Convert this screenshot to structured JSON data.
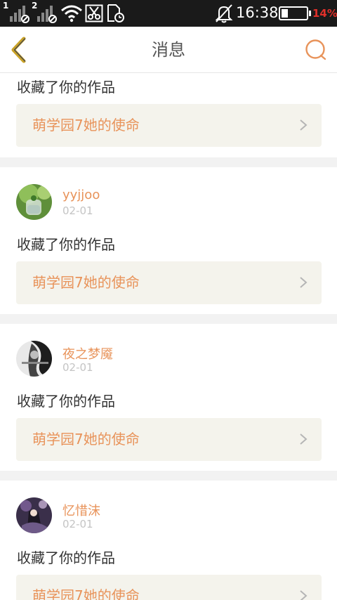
{
  "status_bar": {
    "time": "16:38",
    "battery_percent": "14%",
    "sim1_label": "1",
    "sim2_label": "2"
  },
  "header": {
    "title": "消息"
  },
  "colors": {
    "accent": "#e8935a",
    "back_arrow": "#c9a227",
    "link_bg": "#f4f3ec",
    "divider": "#f2f2f2"
  },
  "messages": [
    {
      "action": "收藏了你的作品",
      "work_title": "萌学园7她的使命"
    },
    {
      "username": "yyjjoo",
      "date": "02-01",
      "action": "收藏了你的作品",
      "work_title": "萌学园7她的使命"
    },
    {
      "username": "夜之梦魇",
      "date": "02-01",
      "action": "收藏了你的作品",
      "work_title": "萌学园7她的使命"
    },
    {
      "username": "忆惜沫",
      "date": "02-01",
      "action": "收藏了你的作品",
      "work_title": "萌学园7她的使命"
    }
  ]
}
